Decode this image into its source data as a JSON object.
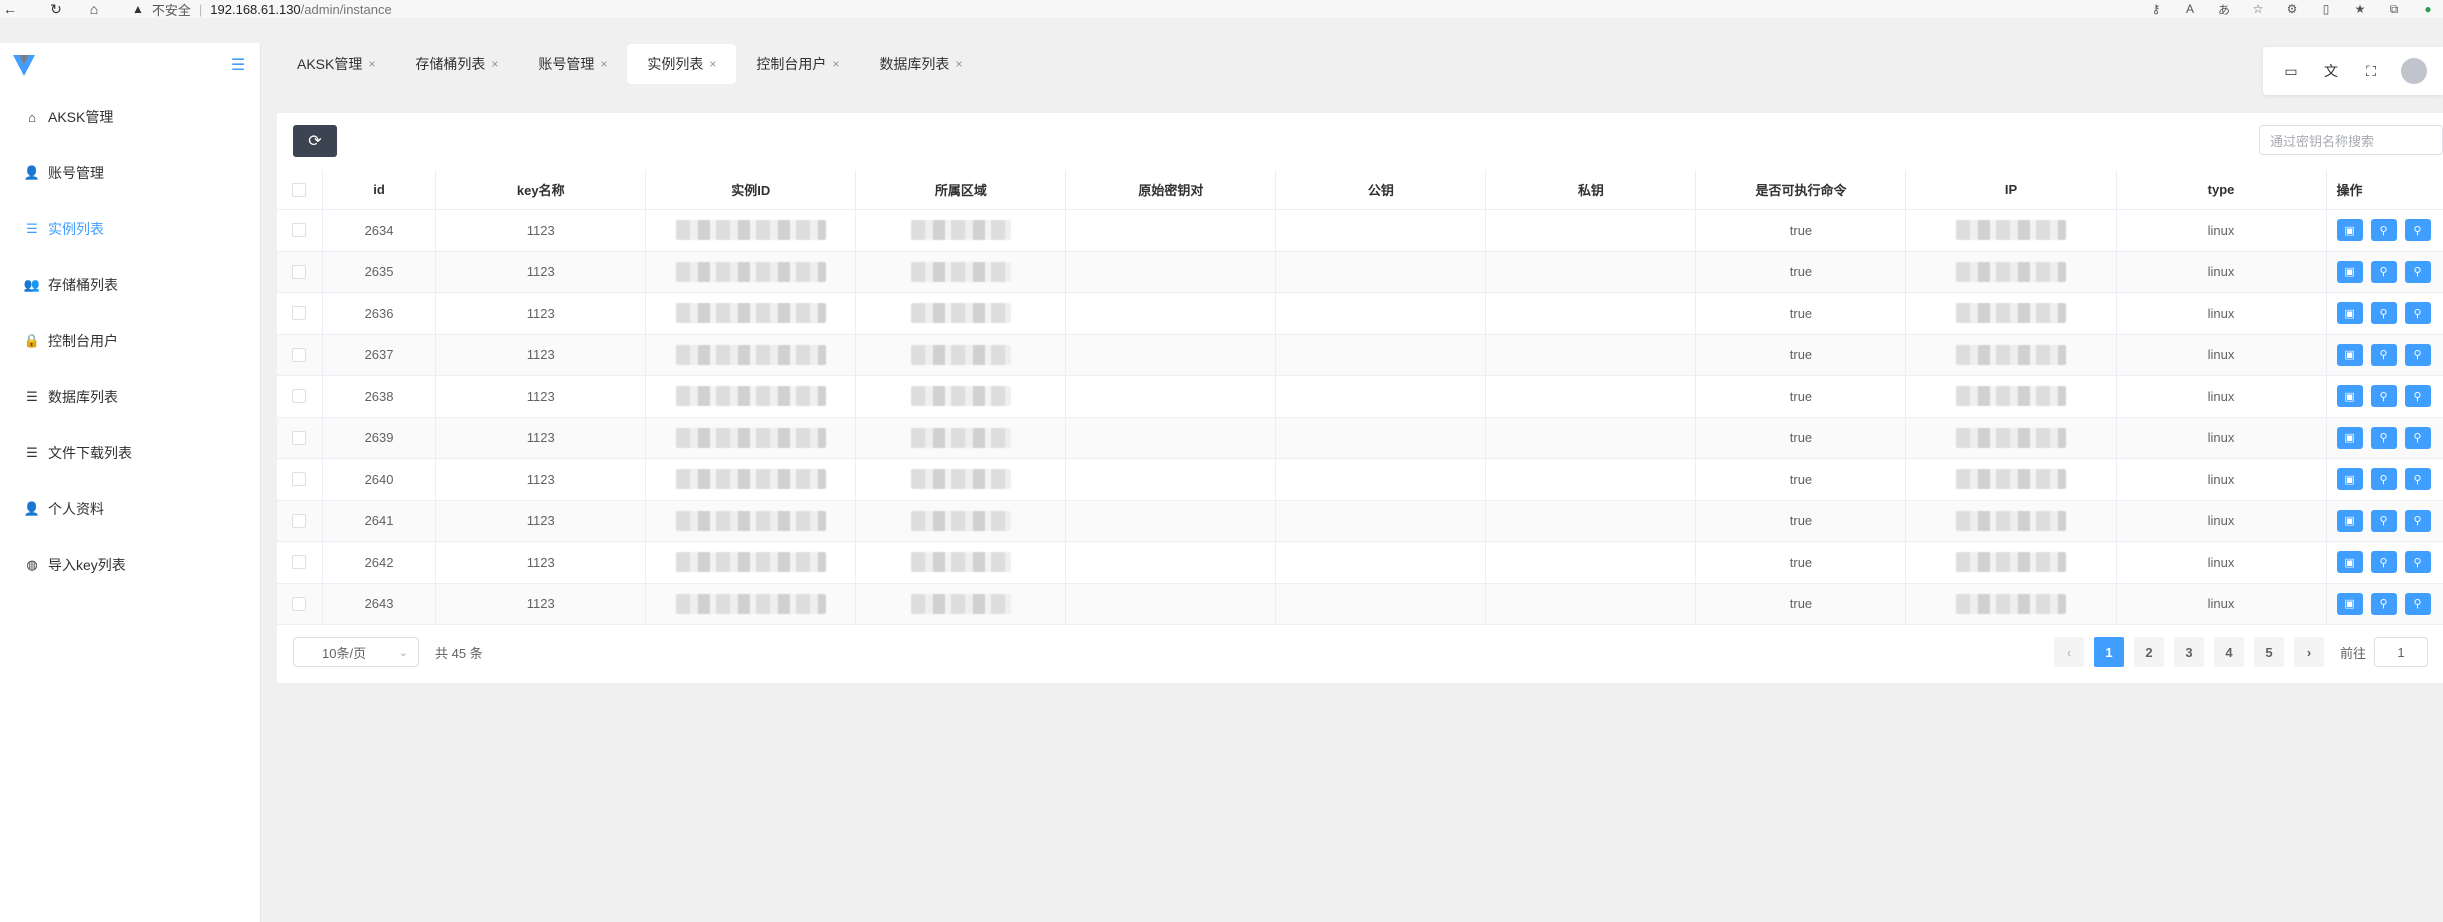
{
  "browser": {
    "security": "不安全",
    "url_host": "192.168.61.130",
    "url_path": "/admin/instance"
  },
  "sidebar": {
    "items": [
      {
        "label": "AKSK管理",
        "icon": "home-icon",
        "glyph": "⌂"
      },
      {
        "label": "账号管理",
        "icon": "user-icon",
        "glyph": "👤"
      },
      {
        "label": "实例列表",
        "icon": "list-icon",
        "glyph": "☰"
      },
      {
        "label": "存储桶列表",
        "icon": "users-icon",
        "glyph": "👥"
      },
      {
        "label": "控制台用户",
        "icon": "lock-icon",
        "glyph": "🔒"
      },
      {
        "label": "数据库列表",
        "icon": "list-icon",
        "glyph": "☰"
      },
      {
        "label": "文件下载列表",
        "icon": "list-icon",
        "glyph": "☰"
      },
      {
        "label": "个人资料",
        "icon": "user-icon",
        "glyph": "👤"
      },
      {
        "label": "导入key列表",
        "icon": "dashboard-icon",
        "glyph": "◍"
      }
    ],
    "active_index": 2
  },
  "tabs": [
    {
      "label": "AKSK管理"
    },
    {
      "label": "存储桶列表"
    },
    {
      "label": "账号管理"
    },
    {
      "label": "实例列表"
    },
    {
      "label": "控制台用户"
    },
    {
      "label": "数据库列表"
    }
  ],
  "active_tab": 3,
  "search": {
    "placeholder": "通过密钥名称搜索"
  },
  "table": {
    "columns": [
      "id",
      "key名称",
      "实例ID",
      "所属区域",
      "原始密钥对",
      "公钥",
      "私钥",
      "是否可执行命令",
      "IP",
      "type",
      "操作"
    ],
    "rows": [
      {
        "id": "2634",
        "key": "1123",
        "exec": "true",
        "type": "linux"
      },
      {
        "id": "2635",
        "key": "1123",
        "exec": "true",
        "type": "linux"
      },
      {
        "id": "2636",
        "key": "1123",
        "exec": "true",
        "type": "linux"
      },
      {
        "id": "2637",
        "key": "1123",
        "exec": "true",
        "type": "linux"
      },
      {
        "id": "2638",
        "key": "1123",
        "exec": "true",
        "type": "linux"
      },
      {
        "id": "2639",
        "key": "1123",
        "exec": "true",
        "type": "linux"
      },
      {
        "id": "2640",
        "key": "1123",
        "exec": "true",
        "type": "linux"
      },
      {
        "id": "2641",
        "key": "1123",
        "exec": "true",
        "type": "linux"
      },
      {
        "id": "2642",
        "key": "1123",
        "exec": "true",
        "type": "linux"
      },
      {
        "id": "2643",
        "key": "1123",
        "exec": "true",
        "type": "linux"
      }
    ]
  },
  "pagination": {
    "page_size": "10条/页",
    "total": "共 45 条",
    "pages": [
      "1",
      "2",
      "3",
      "4",
      "5"
    ],
    "current": "1",
    "goto_label": "前往",
    "goto_value": "1"
  },
  "colors": {
    "accent": "#409eff",
    "refresh_button": "#3d4451"
  }
}
